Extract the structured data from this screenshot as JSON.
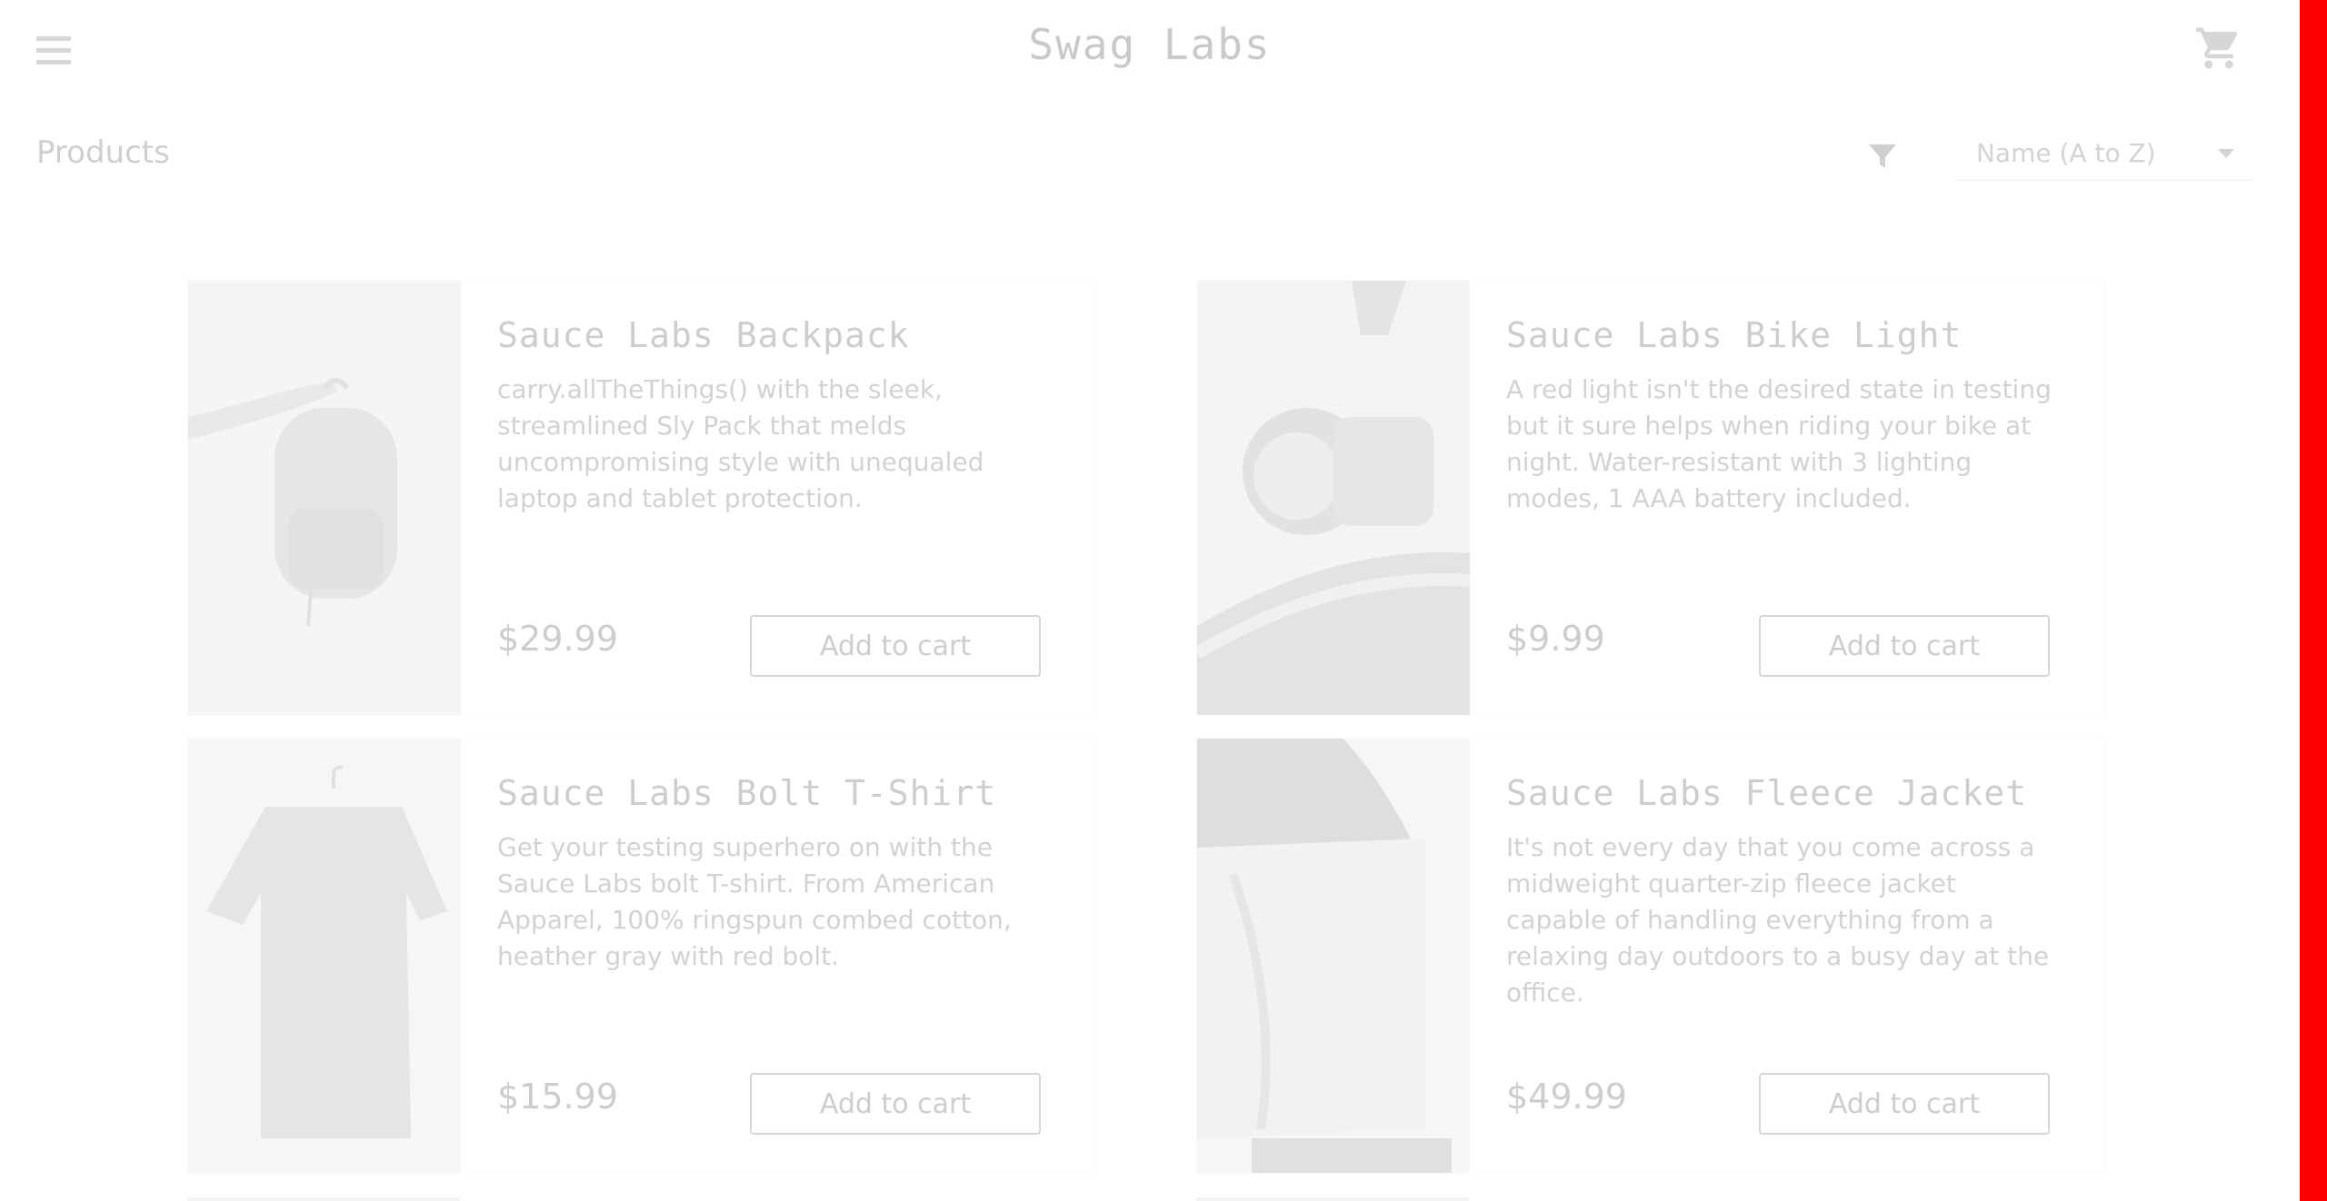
{
  "header": {
    "title": "Swag Labs",
    "menu_icon": "hamburger-menu-icon",
    "cart_icon": "shopping-cart-icon"
  },
  "secondary": {
    "title": "Products",
    "filter_icon": "filter-funnel-icon",
    "sort": {
      "selected": "Name (A to Z)"
    }
  },
  "products": [
    {
      "name": "Sauce Labs Backpack",
      "description": "carry.allTheThings() with the sleek, streamlined Sly Pack that melds uncompromising style with unequaled laptop and tablet protection.",
      "price": "$29.99",
      "button": "Add to cart"
    },
    {
      "name": "Sauce Labs Bike Light",
      "description": "A red light isn't the desired state in testing but it sure helps when riding your bike at night. Water-resistant with 3 lighting modes, 1 AAA battery included.",
      "price": "$9.99",
      "button": "Add to cart"
    },
    {
      "name": "Sauce Labs Bolt T-Shirt",
      "description": "Get your testing superhero on with the Sauce Labs bolt T-shirt. From American Apparel, 100% ringspun combed cotton, heather gray with red bolt.",
      "price": "$15.99",
      "button": "Add to cart"
    },
    {
      "name": "Sauce Labs Fleece Jacket",
      "description": "It's not every day that you come across a midweight quarter-zip fleece jacket capable of handling everything from a relaxing day outdoors to a busy day at the office.",
      "price": "$49.99",
      "button": "Add to cart"
    }
  ],
  "colors": {
    "right_edge_bar": "#ff0000",
    "overlay_text": "#cdcdcd"
  }
}
